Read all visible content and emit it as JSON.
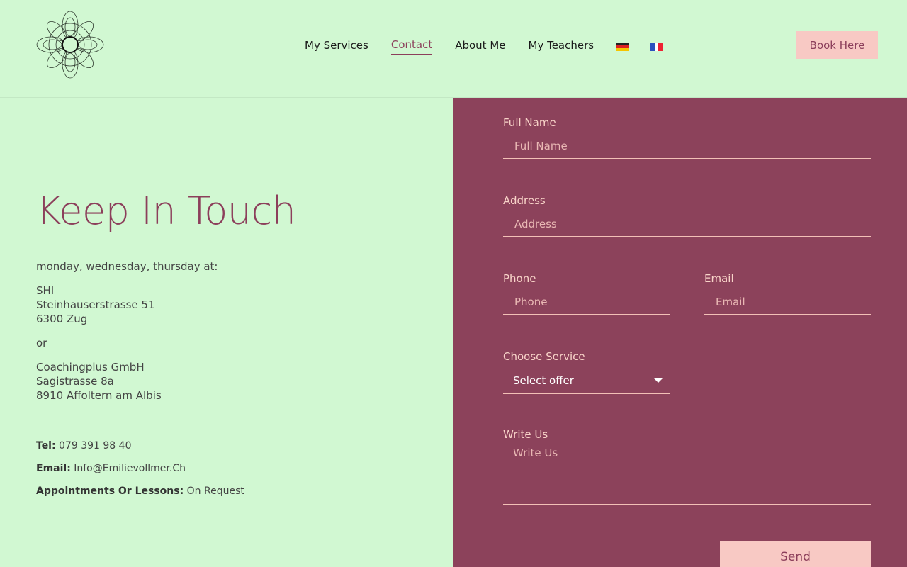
{
  "nav": {
    "items": [
      {
        "label": "My Services",
        "active": false
      },
      {
        "label": "Contact",
        "active": true
      },
      {
        "label": "About Me",
        "active": false
      },
      {
        "label": "My Teachers",
        "active": false
      }
    ],
    "flags": [
      "german-flag-icon",
      "french-flag-icon"
    ],
    "book_label": "Book Here"
  },
  "left": {
    "title": "Keep In Touch",
    "days": "monday, wednesday, thursday at:",
    "location1": {
      "line1": "SHI",
      "line2": "Steinhauserstrasse 51",
      "line3": "6300 Zug"
    },
    "or": "or",
    "location2": {
      "line1": "Coachingplus GmbH",
      "line2": "Sagistrasse 8a",
      "line3": "8910 Affoltern am Albis"
    },
    "tel": {
      "label": "Tel:",
      "value": "079 391 98 40"
    },
    "email": {
      "label": "Email:",
      "value": "Info@Emilievollmer.Ch"
    },
    "appointments": {
      "label": "Appointments Or Lessons:",
      "value": "On Request"
    }
  },
  "form": {
    "full_name": {
      "label": "Full Name",
      "placeholder": "Full Name"
    },
    "address": {
      "label": "Address",
      "placeholder": "Address"
    },
    "phone": {
      "label": "Phone",
      "placeholder": "Phone"
    },
    "email": {
      "label": "Email",
      "placeholder": "Email"
    },
    "service": {
      "label": "Choose Service",
      "value": "Select offer"
    },
    "message": {
      "label": "Write Us",
      "placeholder": "Write Us"
    },
    "send_label": "Send"
  },
  "colors": {
    "background": "#d1f8d2",
    "accent": "#8c425b",
    "button": "#f8c9c4"
  }
}
